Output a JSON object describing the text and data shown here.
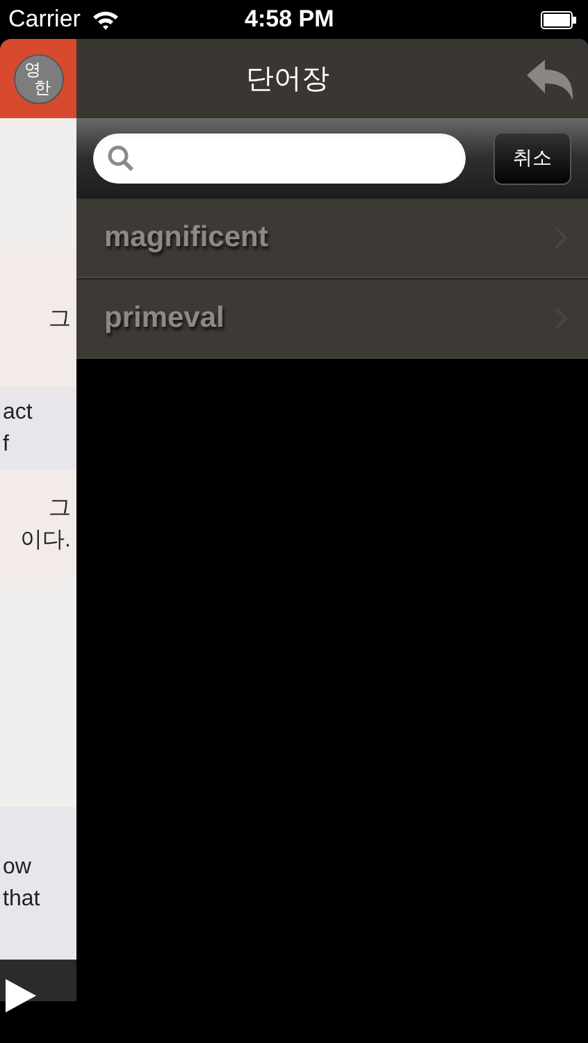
{
  "status_bar": {
    "carrier": "Carrier",
    "time": "4:58 PM"
  },
  "side_panel": {
    "language_toggle": [
      "영",
      "한"
    ],
    "entries": [
      {
        "kind": "blank"
      },
      {
        "kind": "korean",
        "lines": [
          "그"
        ]
      },
      {
        "kind": "english",
        "lines": [
          "act",
          "f"
        ]
      },
      {
        "kind": "korean",
        "lines": [
          "그",
          "이다."
        ]
      },
      {
        "kind": "blank"
      },
      {
        "kind": "english",
        "lines": [
          "ow",
          "that"
        ]
      }
    ]
  },
  "nav_bar": {
    "title": "단어장"
  },
  "search": {
    "cancel": "취소"
  },
  "words": [
    {
      "label": "magnificent"
    },
    {
      "label": "primeval"
    }
  ]
}
